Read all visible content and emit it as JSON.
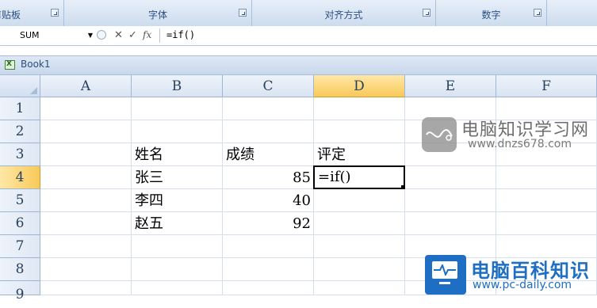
{
  "ribbon": {
    "groups": [
      {
        "label": "剪贴板"
      },
      {
        "label": "字体"
      },
      {
        "label": "对齐方式"
      },
      {
        "label": "数字"
      }
    ]
  },
  "formula_bar": {
    "name_box": "SUM",
    "formula": "=if()",
    "icons": [
      "cancel-icon",
      "enter-icon",
      "insert-function-icon"
    ]
  },
  "workbook": {
    "title": "Book1"
  },
  "grid": {
    "columns": [
      "A",
      "B",
      "C",
      "D",
      "E",
      "F"
    ],
    "rows": [
      "1",
      "2",
      "3",
      "4",
      "5",
      "6",
      "7",
      "8",
      "9"
    ],
    "active_cell": "D4",
    "cells": {
      "B3": "姓名",
      "C3": "成绩",
      "D3": "评定",
      "B4": "张三",
      "C4": "85",
      "D4": "=if()",
      "B5": "李四",
      "C5": "40",
      "B6": "赵五",
      "C6": "92"
    }
  },
  "watermarks": {
    "top_title": "电脑知识学习网",
    "top_url": "www.dnzs678.com",
    "bottom_title": "电脑百科知识",
    "bottom_url": "www.pc-daily.com"
  },
  "colors": {
    "active_header": "#f9c959",
    "header_text": "#27415f",
    "ribbon_text": "#2b4f80",
    "brand_blue": "#1e6fc4"
  }
}
